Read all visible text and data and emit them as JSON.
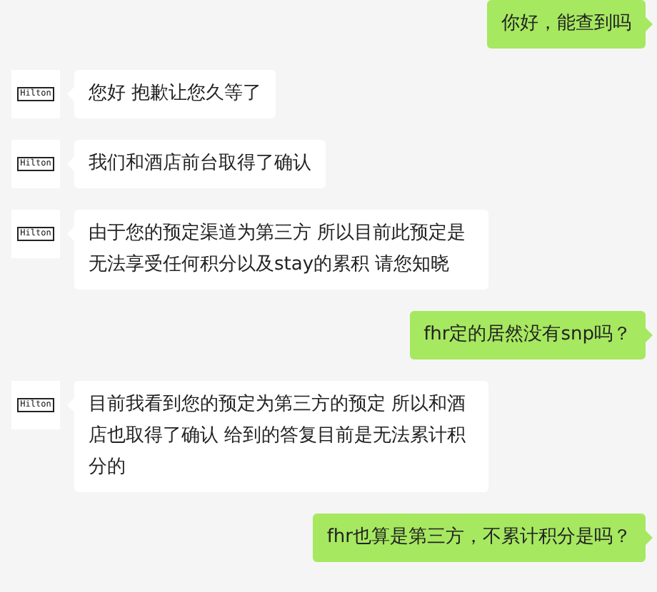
{
  "messages": [
    {
      "outgoing": true,
      "text": "你好，能查到吗"
    },
    {
      "outgoing": false,
      "avatar": "Hilton",
      "text": "您好 抱歉让您久等了"
    },
    {
      "outgoing": false,
      "avatar": "Hilton",
      "text": "我们和酒店前台取得了确认"
    },
    {
      "outgoing": false,
      "avatar": "Hilton",
      "text": "由于您的预定渠道为第三方 所以目前此预定是无法享受任何积分以及stay的累积 请您知晓"
    },
    {
      "outgoing": true,
      "text": "fhr定的居然没有snp吗？"
    },
    {
      "outgoing": false,
      "avatar": "Hilton",
      "text": "目前我看到您的预定为第三方的预定 所以和酒店也取得了确认 给到的答复目前是无法累计积分的"
    },
    {
      "outgoing": true,
      "text": "fhr也算是第三方，不累计积分是吗？"
    }
  ]
}
